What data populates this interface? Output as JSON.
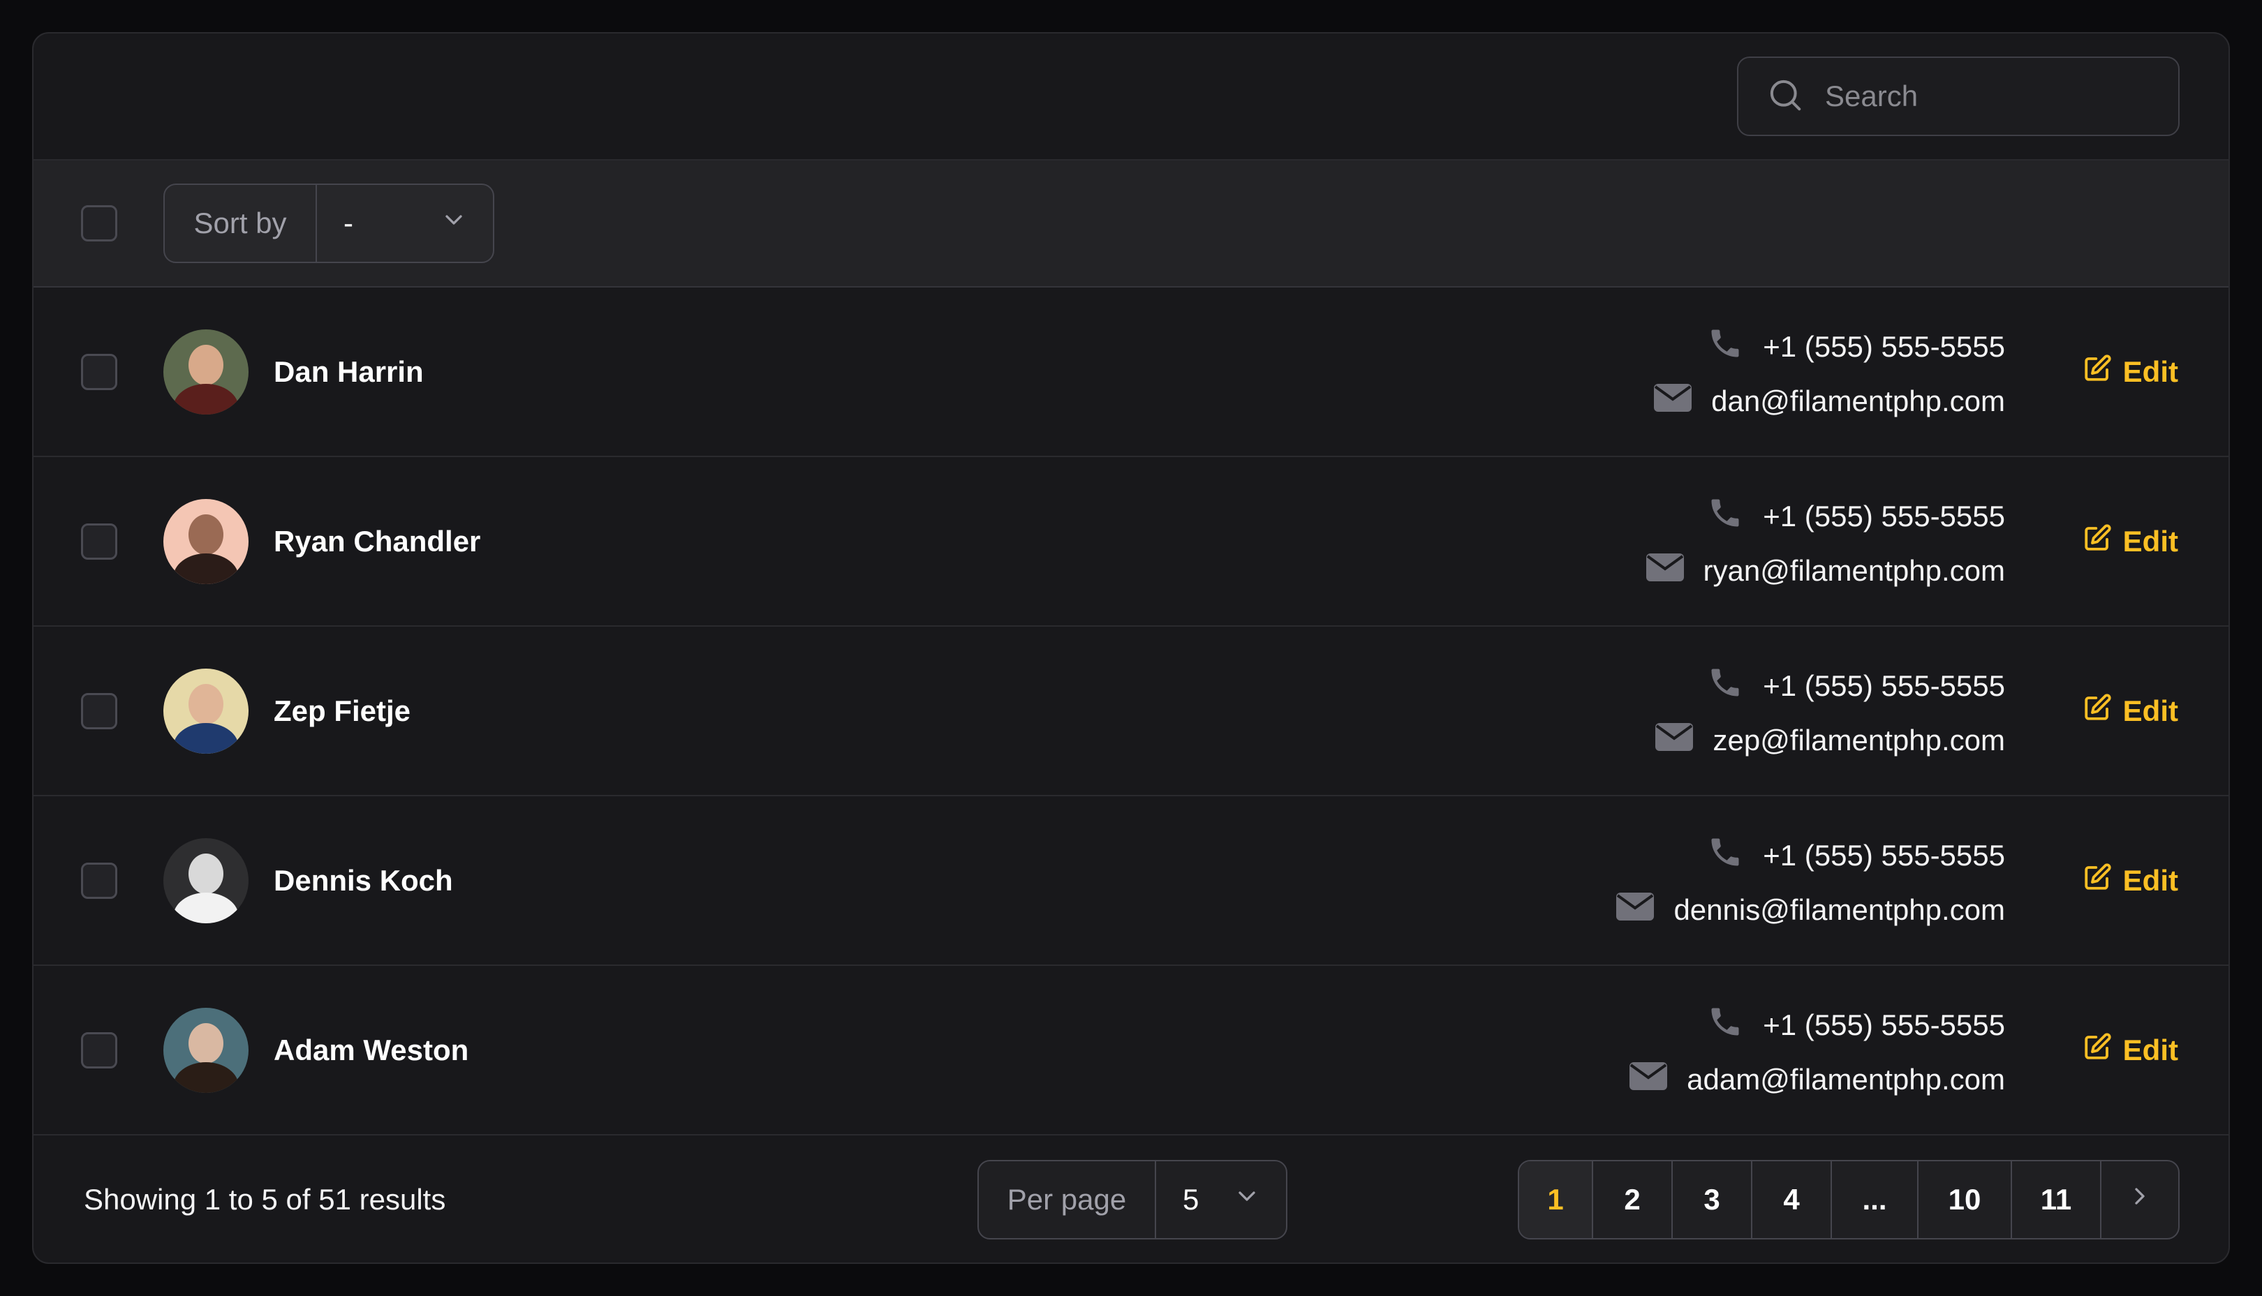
{
  "search": {
    "placeholder": "Search",
    "value": ""
  },
  "toolbar": {
    "sort_label": "Sort by",
    "sort_value": "-"
  },
  "rows": [
    {
      "name": "Dan Harrin",
      "phone": "+1 (555) 555-5555",
      "email": "dan@filamentphp.com",
      "action": "Edit"
    },
    {
      "name": "Ryan Chandler",
      "phone": "+1 (555) 555-5555",
      "email": "ryan@filamentphp.com",
      "action": "Edit"
    },
    {
      "name": "Zep Fietje",
      "phone": "+1 (555) 555-5555",
      "email": "zep@filamentphp.com",
      "action": "Edit"
    },
    {
      "name": "Dennis Koch",
      "phone": "+1 (555) 555-5555",
      "email": "dennis@filamentphp.com",
      "action": "Edit"
    },
    {
      "name": "Adam Weston",
      "phone": "+1 (555) 555-5555",
      "email": "adam@filamentphp.com",
      "action": "Edit"
    }
  ],
  "footer": {
    "summary": "Showing 1 to 5 of 51 results",
    "per_page_label": "Per page",
    "per_page_value": "5"
  },
  "pagination": {
    "pages": [
      "1",
      "2",
      "3",
      "4",
      "...",
      "10",
      "11"
    ],
    "current": "1"
  },
  "colors": {
    "accent": "#fbbf24",
    "background": "#18181b"
  }
}
